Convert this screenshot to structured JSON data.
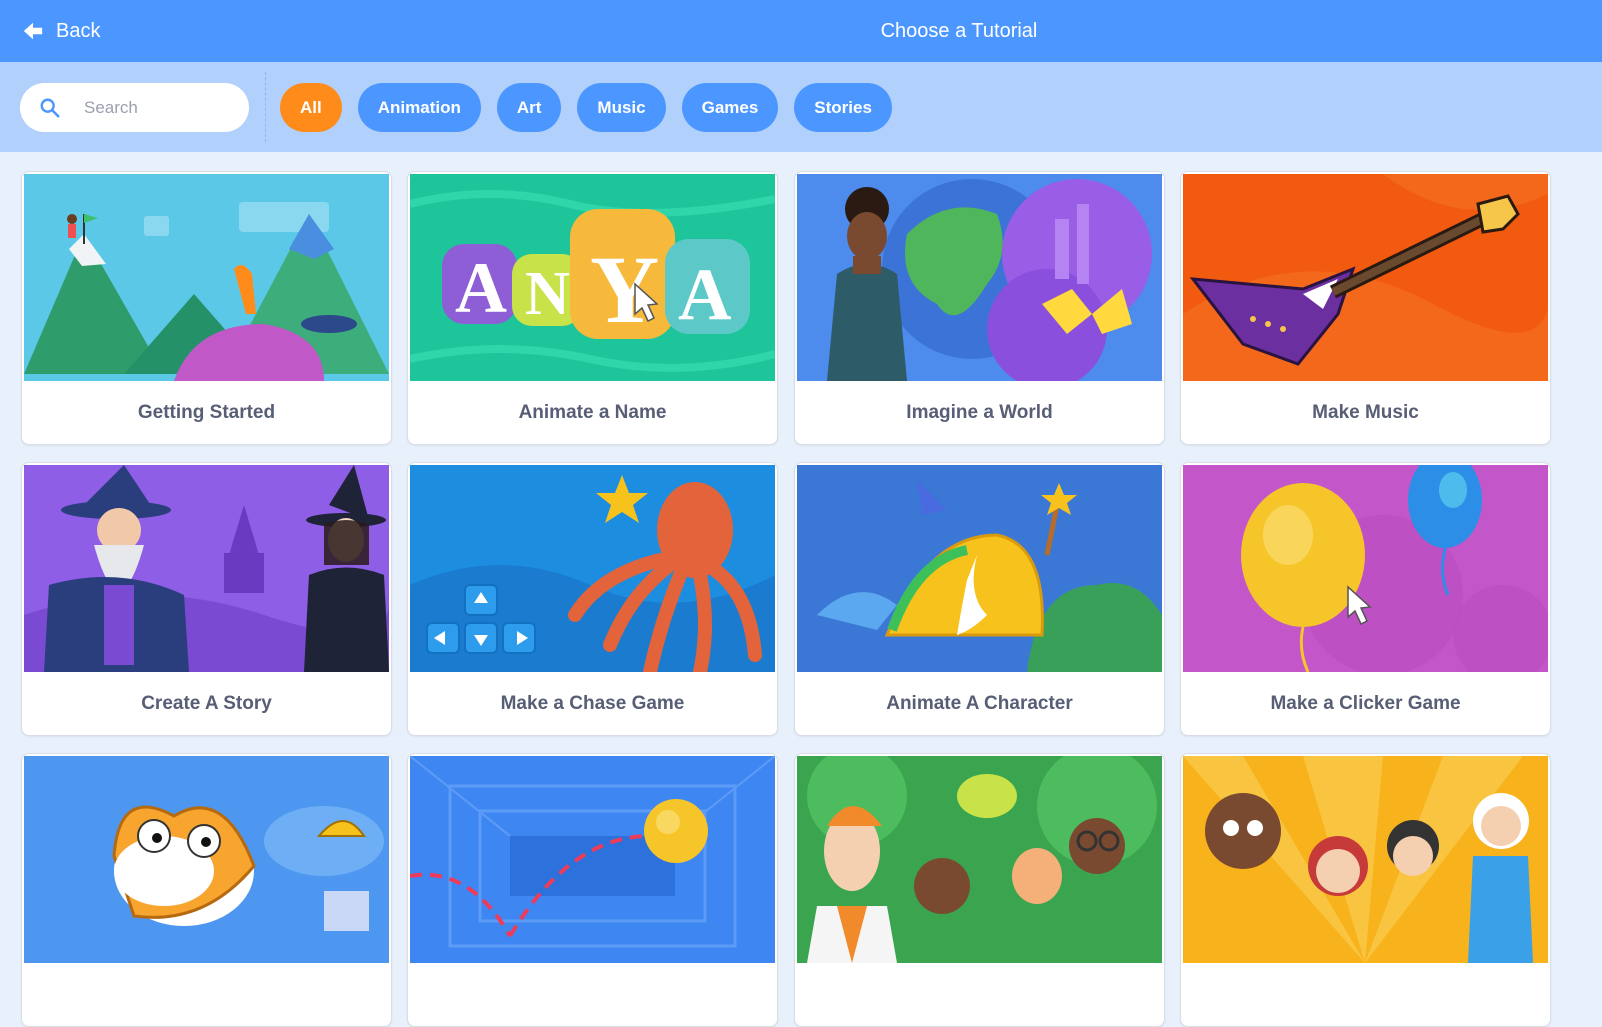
{
  "header": {
    "back_label": "Back",
    "title": "Choose a Tutorial"
  },
  "search": {
    "placeholder": "Search",
    "value": ""
  },
  "filters": [
    {
      "label": "All",
      "active": true
    },
    {
      "label": "Animation",
      "active": false
    },
    {
      "label": "Art",
      "active": false
    },
    {
      "label": "Music",
      "active": false
    },
    {
      "label": "Games",
      "active": false
    },
    {
      "label": "Stories",
      "active": false
    }
  ],
  "tutorials": [
    {
      "title": "Getting Started"
    },
    {
      "title": "Animate a Name"
    },
    {
      "title": "Imagine a World"
    },
    {
      "title": "Make Music"
    },
    {
      "title": "Create A Story"
    },
    {
      "title": "Make a Chase Game"
    },
    {
      "title": "Animate A Character"
    },
    {
      "title": "Make a Clicker Game"
    },
    {
      "title": ""
    },
    {
      "title": ""
    },
    {
      "title": ""
    },
    {
      "title": ""
    }
  ],
  "colors": {
    "header": "#4c97ff",
    "filterbar": "#b1d0fc",
    "active_chip": "#ff8c1a",
    "chip": "#4c97ff",
    "card_text": "#575e75"
  }
}
